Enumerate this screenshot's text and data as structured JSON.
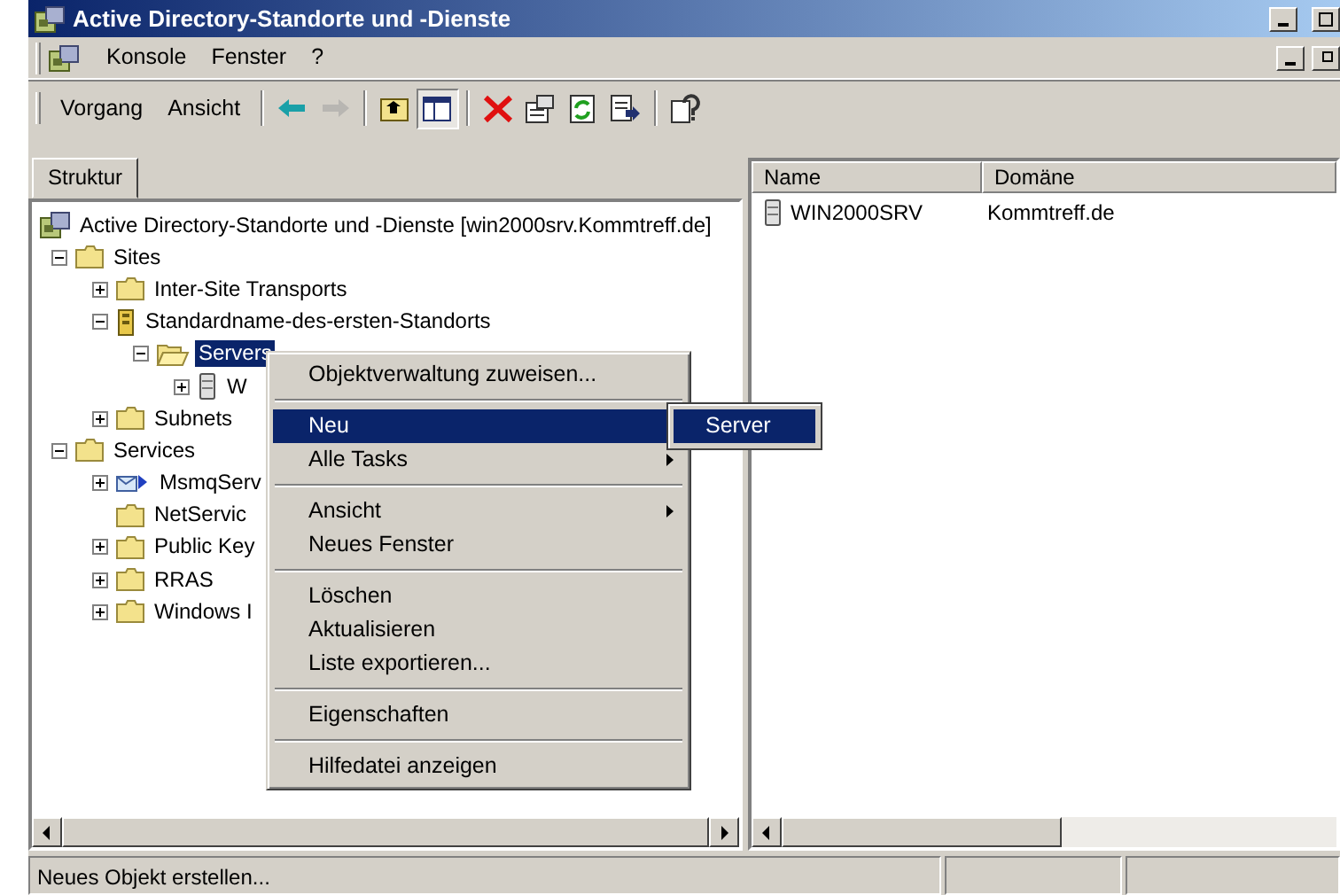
{
  "window": {
    "title": "Active Directory-Standorte und -Dienste"
  },
  "menu_bar": [
    "Konsole",
    "Fenster",
    "?"
  ],
  "toolbar": {
    "menus": [
      "Vorgang",
      "Ansicht"
    ],
    "buttons": [
      {
        "kind": "back",
        "disabled": false,
        "pressed": false
      },
      {
        "kind": "forward",
        "disabled": true,
        "pressed": false
      },
      {
        "kind": "up",
        "disabled": false,
        "pressed": false
      },
      {
        "kind": "pane",
        "disabled": false,
        "pressed": true
      },
      {
        "kind": "delete",
        "disabled": false,
        "pressed": false
      },
      {
        "kind": "properties",
        "disabled": false,
        "pressed": false
      },
      {
        "kind": "refresh",
        "disabled": false,
        "pressed": false
      },
      {
        "kind": "export",
        "disabled": false,
        "pressed": false
      },
      {
        "kind": "help",
        "disabled": false,
        "pressed": false
      }
    ]
  },
  "tree_tab": {
    "label": "Struktur",
    "selected": true
  },
  "tree": [
    {
      "label": "Active Directory-Standorte und -Dienste [win2000srv.Kommtreff.de]",
      "kind": "console",
      "selected": false,
      "children": [
        {
          "label": "Sites",
          "kind": "folder",
          "expanded": true,
          "selected": false,
          "children": [
            {
              "label": "Inter-Site Transports",
              "kind": "folder",
              "expanded": false,
              "selected": false
            },
            {
              "label": "Standardname-des-ersten-Standorts",
              "kind": "site",
              "expanded": true,
              "selected": false,
              "children": [
                {
                  "label": "Servers",
                  "kind": "openfolder",
                  "expanded": true,
                  "selected": true,
                  "children": [
                    {
                      "label": "W",
                      "kind": "server",
                      "expanded": false,
                      "selected": false
                    }
                  ]
                }
              ]
            },
            {
              "label": "Subnets",
              "kind": "folder",
              "expanded": false,
              "selected": false
            }
          ]
        },
        {
          "label": "Services",
          "kind": "folder",
          "expanded": true,
          "selected": false,
          "children": [
            {
              "label": "MsmqServ",
              "kind": "msmq",
              "expanded": false,
              "selected": false
            },
            {
              "label": "NetServic",
              "kind": "folder",
              "selected": false
            },
            {
              "label": "Public Key",
              "kind": "folder",
              "expanded": false,
              "selected": false
            },
            {
              "label": "RRAS",
              "kind": "folder",
              "expanded": false,
              "selected": false
            },
            {
              "label": "Windows I",
              "kind": "folder",
              "expanded": false,
              "selected": false
            }
          ]
        }
      ]
    }
  ],
  "list": {
    "columns": [
      "Name",
      "Domäne"
    ],
    "rows": [
      {
        "kind": "server",
        "cells": [
          "WIN2000SRV",
          "Kommtreff.de"
        ]
      }
    ]
  },
  "context_menu": [
    {
      "kind": "item",
      "label": "Objektverwaltung zuweisen...",
      "submenu": false,
      "selected": false
    },
    {
      "kind": "separator"
    },
    {
      "kind": "item",
      "label": "Neu",
      "submenu": true,
      "selected": true
    },
    {
      "kind": "item",
      "label": "Alle Tasks",
      "submenu": true,
      "selected": false
    },
    {
      "kind": "separator"
    },
    {
      "kind": "item",
      "label": "Ansicht",
      "submenu": true,
      "selected": false
    },
    {
      "kind": "item",
      "label": "Neues Fenster",
      "submenu": false,
      "selected": false
    },
    {
      "kind": "separator"
    },
    {
      "kind": "item",
      "label": "Löschen",
      "submenu": false,
      "selected": false
    },
    {
      "kind": "item",
      "label": "Aktualisieren",
      "submenu": false,
      "selected": false
    },
    {
      "kind": "item",
      "label": "Liste exportieren...",
      "submenu": false,
      "selected": false
    },
    {
      "kind": "separator"
    },
    {
      "kind": "item",
      "label": "Eigenschaften",
      "submenu": false,
      "selected": false
    },
    {
      "kind": "separator"
    },
    {
      "kind": "item",
      "label": "Hilfedatei anzeigen",
      "submenu": false,
      "selected": false
    }
  ],
  "submenu": [
    {
      "label": "Server",
      "selected": true
    }
  ],
  "status_bar": {
    "text": "Neues Objekt erstellen..."
  }
}
